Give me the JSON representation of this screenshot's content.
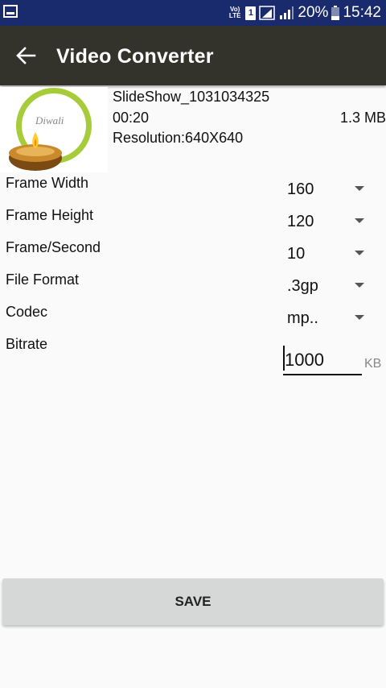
{
  "status_bar": {
    "network": "VoLTE",
    "sim_slot": "1",
    "battery": "20%",
    "time": "15:42"
  },
  "toolbar": {
    "title": "Video Converter"
  },
  "media": {
    "name": "SlideShow_1031034325",
    "duration": "00:20",
    "size": "1.3 MB",
    "resolution": "Resolution:640X640",
    "thumbnail_icon": "diwali-lamp-image"
  },
  "settings": [
    {
      "label": "Frame Width",
      "value": "160"
    },
    {
      "label": "Frame Height",
      "value": "120"
    },
    {
      "label": "Frame/Second",
      "value": "10"
    },
    {
      "label": "File Format",
      "value": ".3gp"
    },
    {
      "label": "Codec",
      "value": "mp.."
    }
  ],
  "bitrate": {
    "label": "Bitrate",
    "value": "1000",
    "unit": "KB"
  },
  "save_label": "SAVE"
}
